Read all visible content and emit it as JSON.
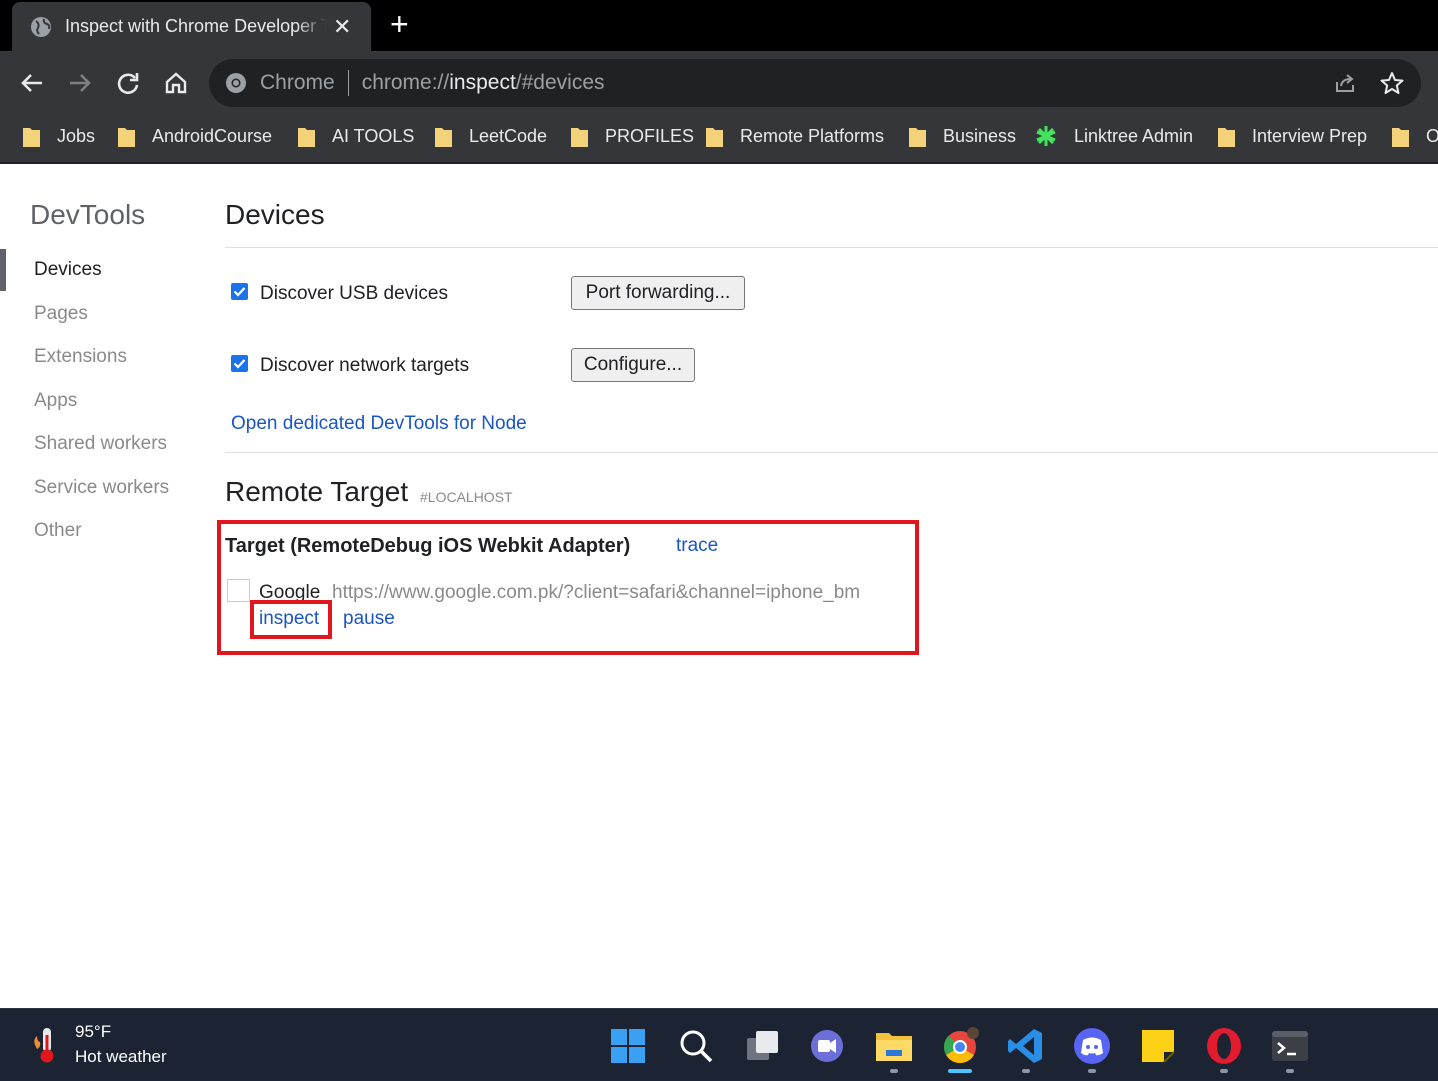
{
  "browser": {
    "tab_title": "Inspect with Chrome Developer Tools",
    "omnibox_chip": "Chrome",
    "url_scheme": "chrome://",
    "url_host": "inspect",
    "url_path": "/#devices",
    "bookmarks": [
      "Jobs",
      "AndroidCourse",
      "AI TOOLS",
      "LeetCode",
      "PROFILES",
      "Remote Platforms",
      "Business",
      "Linktree Admin",
      "Interview Prep",
      "O"
    ]
  },
  "sidebar": {
    "title": "DevTools",
    "items": [
      "Devices",
      "Pages",
      "Extensions",
      "Apps",
      "Shared workers",
      "Service workers",
      "Other"
    ],
    "active": "Devices"
  },
  "main": {
    "title": "Devices",
    "discover_usb": {
      "label": "Discover USB devices",
      "checked": true,
      "button": "Port forwarding..."
    },
    "discover_network": {
      "label": "Discover network targets",
      "checked": true,
      "button": "Configure..."
    },
    "node_link": "Open dedicated DevTools for Node",
    "remote_target": {
      "title": "Remote Target",
      "tag": "#LOCALHOST",
      "target_name": "Target (RemoteDebug iOS Webkit Adapter)",
      "trace_link": "trace",
      "page_name": "Google",
      "page_url": "https://www.google.com.pk/?client=safari&channel=iphone_bm",
      "inspect_link": "inspect",
      "pause_link": "pause"
    }
  },
  "taskbar": {
    "weather_temp": "95°F",
    "weather_desc": "Hot weather",
    "apps": [
      "start-icon",
      "search-icon",
      "task-view-icon",
      "teams-chat-icon",
      "file-explorer-icon",
      "chrome-icon",
      "vscode-icon",
      "discord-icon",
      "sticky-notes-icon",
      "opera-icon",
      "terminal-icon"
    ]
  },
  "colors": {
    "highlight": "#e0161f",
    "link": "#1a56c6",
    "checkbox": "#1a73e8"
  }
}
